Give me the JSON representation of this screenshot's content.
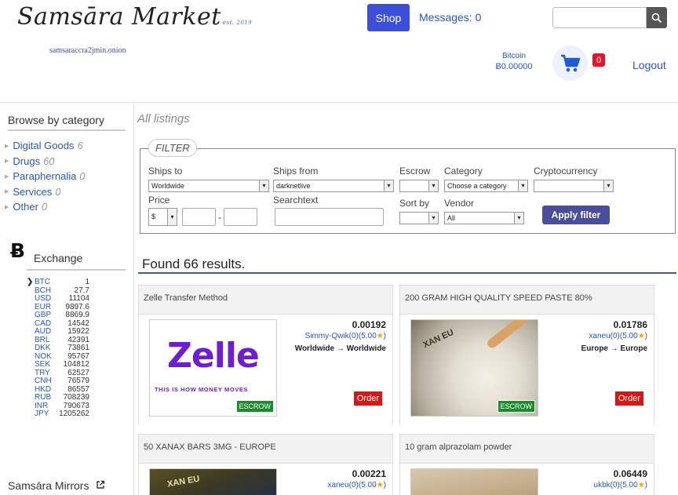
{
  "header": {
    "logo": "Samsāra Market",
    "logo_tag": "est. 2019",
    "onion": "samsaraccra2jmin.onion",
    "shop": "Shop",
    "messages": "Messages: 0",
    "search_value": "",
    "bitcoin_label": "Bitcoin",
    "bitcoin_balance": "Ƀ0.00000",
    "cart_count": "0",
    "logout": "Logout"
  },
  "sidebar": {
    "browse_title": "Browse by category",
    "categories": [
      {
        "label": "Digital Goods",
        "count": "6"
      },
      {
        "label": "Drugs",
        "count": "60"
      },
      {
        "label": "Paraphernalia",
        "count": "0"
      },
      {
        "label": "Services",
        "count": "0"
      },
      {
        "label": "Other",
        "count": "0"
      }
    ],
    "btc_symbol": "Ƀ",
    "exchange_title": "Exchange",
    "rates": [
      {
        "cur": "BTC",
        "val": "1",
        "selected": true
      },
      {
        "cur": "BCH",
        "val": "27.7"
      },
      {
        "cur": "USD",
        "val": "11104"
      },
      {
        "cur": "EUR",
        "val": "9897.6"
      },
      {
        "cur": "GBP",
        "val": "8869.9"
      },
      {
        "cur": "CAD",
        "val": "14542"
      },
      {
        "cur": "AUD",
        "val": "15922"
      },
      {
        "cur": "BRL",
        "val": "42391"
      },
      {
        "cur": "DKK",
        "val": "73861"
      },
      {
        "cur": "NOK",
        "val": "95767"
      },
      {
        "cur": "SEK",
        "val": "104812"
      },
      {
        "cur": "TRY",
        "val": "62527"
      },
      {
        "cur": "CNH",
        "val": "76579"
      },
      {
        "cur": "HKD",
        "val": "86557"
      },
      {
        "cur": "RUB",
        "val": "708239"
      },
      {
        "cur": "INR",
        "val": "790673"
      },
      {
        "cur": "JPY",
        "val": "1205262"
      }
    ],
    "mirrors": "Samsāra Mirrors"
  },
  "main": {
    "all_listings": "All listings",
    "filter": {
      "legend": "FILTER",
      "ships_to_label": "Ships to",
      "ships_to_value": "Worldwide",
      "ships_from_label": "Ships from",
      "ships_from_value": "darknetlive",
      "escrow_label": "Escrow",
      "escrow_value": "",
      "category_label": "Category",
      "category_value": "Choose a category",
      "crypto_label": "Cryptocurrency",
      "crypto_value": "",
      "price_label": "Price",
      "price_currency": "$",
      "price_sep": "-",
      "searchtext_label": "Searchtext",
      "sortby_label": "Sort by",
      "sortby_value": "",
      "vendor_label": "Vendor",
      "vendor_value": "All",
      "apply": "Apply filter"
    },
    "results_title": "Found 66 results.",
    "listings": [
      {
        "title": "Zelle Transfer Method",
        "price": "0.00192",
        "vendor": "Simmy-Qwik(0)(5.00",
        "route": "Worldwide → Worldwide",
        "escrow": "ESCROW",
        "order": "Order",
        "brand": "Zelle",
        "tagline": "THIS IS HOW MONEY MOVES"
      },
      {
        "title": "200 GRAM HIGH QUALITY SPEED PASTE 80%",
        "price": "0.01786",
        "vendor": "xaneu(0)(5.00",
        "route": "Europe → Europe",
        "escrow": "ESCROW",
        "order": "Order",
        "bag_text": "XAN EU"
      },
      {
        "title": "50 XANAX BARS 3MG - EUROPE",
        "price": "0.00221",
        "vendor": "xaneu(0)(5.00",
        "bag_text": "XAN EU"
      },
      {
        "title": "10 gram alprazolam powder",
        "price": "0.06449",
        "vendor": "ukbk(0)(5.00"
      }
    ]
  }
}
